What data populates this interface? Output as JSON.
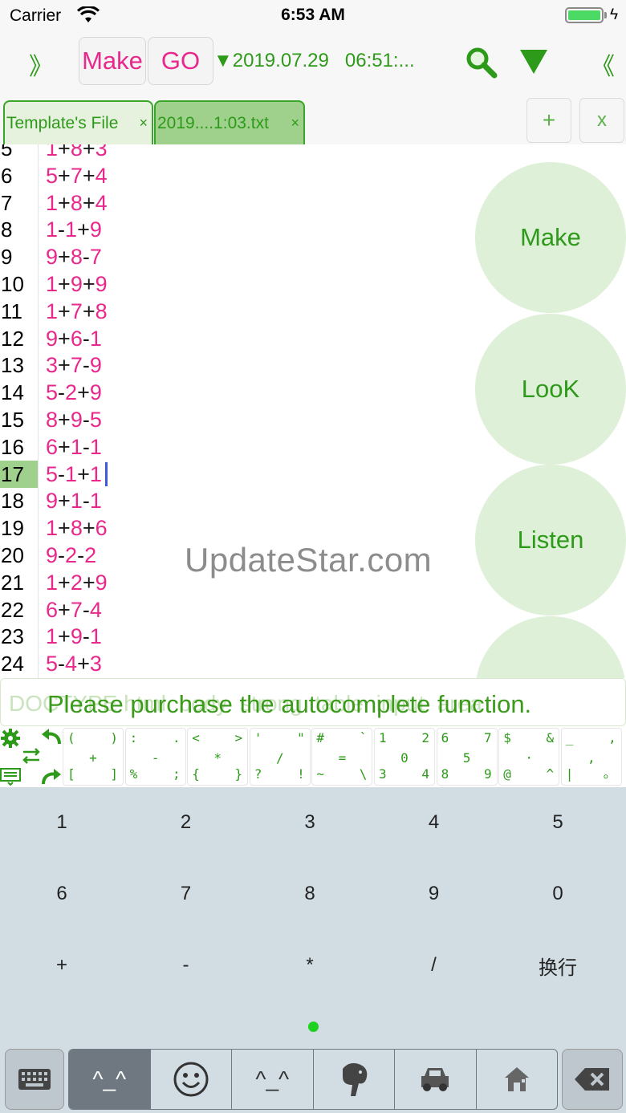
{
  "status_bar": {
    "carrier": "Carrier",
    "time": "6:53 AM"
  },
  "toolbar": {
    "left_chevron": "》",
    "make_label": "Make",
    "go_label": "GO",
    "datetime": "▼2019.07.29   06:51:...",
    "right_chevron": "《",
    "accent_color": "#2e9a1a",
    "pink_color": "#e8288c"
  },
  "tabs": [
    {
      "label": "Template's File",
      "close": "×"
    },
    {
      "label": "2019....1:03.txt",
      "close": "×"
    }
  ],
  "tab_actions": {
    "add": "+",
    "close": "x"
  },
  "editor": {
    "lines": [
      {
        "num": "5",
        "a": "1",
        "o1": "+",
        "b": "8",
        "o2": "+",
        "c": "3"
      },
      {
        "num": "6",
        "a": "5",
        "o1": "+",
        "b": "7",
        "o2": "+",
        "c": "4"
      },
      {
        "num": "7",
        "a": "1",
        "o1": "+",
        "b": "8",
        "o2": "+",
        "c": "4"
      },
      {
        "num": "8",
        "a": "1",
        "o1": "-",
        "b": "1",
        "o2": "+",
        "c": "9"
      },
      {
        "num": "9",
        "a": "9",
        "o1": "+",
        "b": "8",
        "o2": "-",
        "c": "7"
      },
      {
        "num": "10",
        "a": "1",
        "o1": "+",
        "b": "9",
        "o2": "+",
        "c": "9"
      },
      {
        "num": "11",
        "a": "1",
        "o1": "+",
        "b": "7",
        "o2": "+",
        "c": "8"
      },
      {
        "num": "12",
        "a": "9",
        "o1": "+",
        "b": "6",
        "o2": "-",
        "c": "1"
      },
      {
        "num": "13",
        "a": "3",
        "o1": "+",
        "b": "7",
        "o2": "-",
        "c": "9"
      },
      {
        "num": "14",
        "a": "5",
        "o1": "-",
        "b": "2",
        "o2": "+",
        "c": "9"
      },
      {
        "num": "15",
        "a": "8",
        "o1": "+",
        "b": "9",
        "o2": "-",
        "c": "5"
      },
      {
        "num": "16",
        "a": "6",
        "o1": "+",
        "b": "1",
        "o2": "-",
        "c": "1"
      },
      {
        "num": "17",
        "a": "5",
        "o1": "-",
        "b": "1",
        "o2": "+",
        "c": "1"
      },
      {
        "num": "18",
        "a": "9",
        "o1": "+",
        "b": "1",
        "o2": "-",
        "c": "1"
      },
      {
        "num": "19",
        "a": "1",
        "o1": "+",
        "b": "8",
        "o2": "+",
        "c": "6"
      },
      {
        "num": "20",
        "a": "9",
        "o1": "-",
        "b": "2",
        "o2": "-",
        "c": "2"
      },
      {
        "num": "21",
        "a": "1",
        "o1": "+",
        "b": "2",
        "o2": "+",
        "c": "9"
      },
      {
        "num": "22",
        "a": "6",
        "o1": "+",
        "b": "7",
        "o2": "-",
        "c": "4"
      },
      {
        "num": "23",
        "a": "1",
        "o1": "+",
        "b": "9",
        "o2": "-",
        "c": "1"
      },
      {
        "num": "24",
        "a": "5",
        "o1": "-",
        "b": "4",
        "o2": "+",
        "c": "3"
      }
    ],
    "active_line": "17",
    "watermark": "UpdateStar.com"
  },
  "side_buttons": [
    "Make",
    "LooK",
    "Listen"
  ],
  "autocomplete": {
    "ghost_text": "DOCTYPE html  body  strong  table  input  area",
    "message": "Please purchase the autocomplete function."
  },
  "symbol_keys": [
    {
      "tl": "(",
      "tr": ")",
      "m": "+",
      "bl": "[",
      "br": "]"
    },
    {
      "tl": ":",
      "tr": ".",
      "m": "-",
      "bl": "%",
      "br": ";"
    },
    {
      "tl": "<",
      "tr": ">",
      "m": "*",
      "bl": "{",
      "br": "}"
    },
    {
      "tl": "'",
      "tr": "\"",
      "m": "/",
      "bl": "?",
      "br": "!"
    },
    {
      "tl": "#",
      "tr": "`",
      "m": "=",
      "bl": "~",
      "br": "\\"
    },
    {
      "tl": "1",
      "tr": "2",
      "m": "0",
      "bl": "3",
      "br": "4"
    },
    {
      "tl": "6",
      "tr": "7",
      "m": "5",
      "bl": "8",
      "br": "9"
    },
    {
      "tl": "$",
      "tr": "&",
      "m": "·",
      "bl": "@",
      "br": "^"
    },
    {
      "tl": "_",
      "tr": ",",
      "m": ",",
      "bl": "|",
      "br": "。"
    }
  ],
  "keyboard": {
    "rows": [
      [
        "1",
        "2",
        "3",
        "4",
        "5"
      ],
      [
        "6",
        "7",
        "8",
        "9",
        "0"
      ],
      [
        "+",
        "-",
        "*",
        "/",
        "换行"
      ]
    ],
    "bottom_tabs": [
      "^_^",
      "☺",
      "^_^",
      "",
      "",
      ""
    ]
  }
}
